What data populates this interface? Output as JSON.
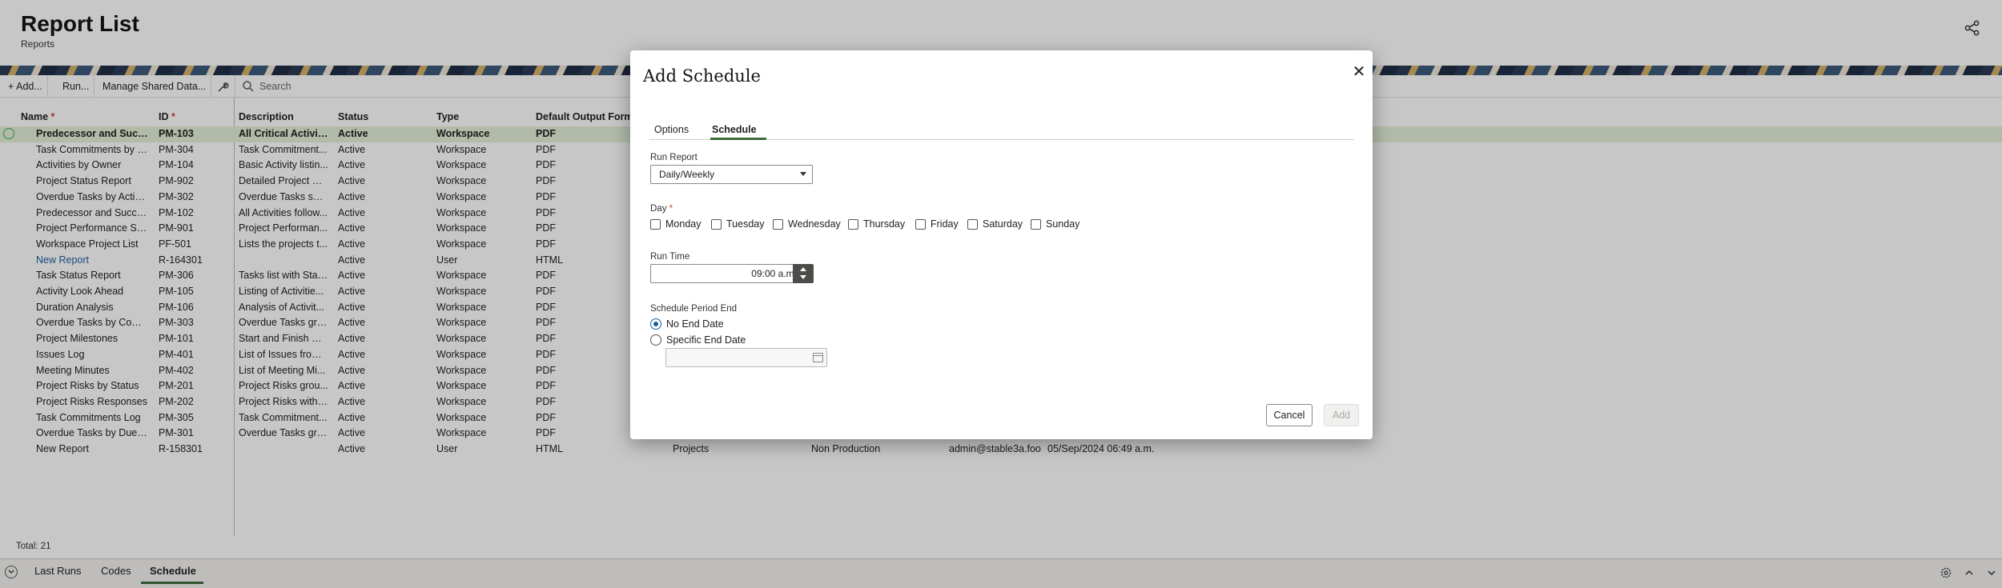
{
  "header": {
    "title": "Report List",
    "subtitle": "Reports",
    "share_icon": "share-icon"
  },
  "toolbar": {
    "add_label": "Add...",
    "run_label": "Run...",
    "manage_label": "Manage Shared Data...",
    "search_placeholder": "Search"
  },
  "table": {
    "headers": {
      "name": "Name",
      "id": "ID",
      "description": "Description",
      "status": "Status",
      "type": "Type",
      "format": "Default Output Format"
    },
    "rows": [
      {
        "name": "Predecessor and Succe...",
        "id": "PM-103",
        "desc": "All Critical Activiti...",
        "status": "Active",
        "type": "Workspace",
        "fmt": "PDF"
      },
      {
        "name": "Task Commitments by S...",
        "id": "PM-304",
        "desc": "Task Commitment...",
        "status": "Active",
        "type": "Workspace",
        "fmt": "PDF"
      },
      {
        "name": "Activities by Owner",
        "id": "PM-104",
        "desc": "Basic Activity listin...",
        "status": "Active",
        "type": "Workspace",
        "fmt": "PDF"
      },
      {
        "name": "Project Status Report",
        "id": "PM-902",
        "desc": "Detailed Project St...",
        "status": "Active",
        "type": "Workspace",
        "fmt": "PDF"
      },
      {
        "name": "Overdue Tasks by Activi...",
        "id": "PM-302",
        "desc": "Overdue Tasks sor...",
        "status": "Active",
        "type": "Workspace",
        "fmt": "PDF"
      },
      {
        "name": "Predecessor and Succes...",
        "id": "PM-102",
        "desc": "All Activities follow...",
        "status": "Active",
        "type": "Workspace",
        "fmt": "PDF"
      },
      {
        "name": "Project Performance Su...",
        "id": "PM-901",
        "desc": "Project Performan...",
        "status": "Active",
        "type": "Workspace",
        "fmt": "PDF"
      },
      {
        "name": "Workspace Project List",
        "id": "PF-501",
        "desc": "Lists the projects t...",
        "status": "Active",
        "type": "Workspace",
        "fmt": "PDF"
      },
      {
        "name": "New Report",
        "id": "R-164301",
        "desc": "",
        "status": "Active",
        "type": "User",
        "fmt": "HTML",
        "link": true
      },
      {
        "name": "Task Status Report",
        "id": "PM-306",
        "desc": "Tasks list with Stat...",
        "status": "Active",
        "type": "Workspace",
        "fmt": "PDF"
      },
      {
        "name": "Activity Look Ahead",
        "id": "PM-105",
        "desc": "Listing of Activitie...",
        "status": "Active",
        "type": "Workspace",
        "fmt": "PDF"
      },
      {
        "name": "Duration Analysis",
        "id": "PM-106",
        "desc": "Analysis of Activit...",
        "status": "Active",
        "type": "Workspace",
        "fmt": "PDF"
      },
      {
        "name": "Overdue Tasks by Comp...",
        "id": "PM-303",
        "desc": "Overdue Tasks gro...",
        "status": "Active",
        "type": "Workspace",
        "fmt": "PDF"
      },
      {
        "name": "Project Milestones",
        "id": "PM-101",
        "desc": "Start and Finish Mi...",
        "status": "Active",
        "type": "Workspace",
        "fmt": "PDF"
      },
      {
        "name": "Issues Log",
        "id": "PM-401",
        "desc": "List of Issues from ...",
        "status": "Active",
        "type": "Workspace",
        "fmt": "PDF"
      },
      {
        "name": "Meeting Minutes",
        "id": "PM-402",
        "desc": "List of Meeting Mi...",
        "status": "Active",
        "type": "Workspace",
        "fmt": "PDF"
      },
      {
        "name": "Project Risks by Status",
        "id": "PM-201",
        "desc": "Project Risks grou...",
        "status": "Active",
        "type": "Workspace",
        "fmt": "PDF"
      },
      {
        "name": "Project Risks Responses",
        "id": "PM-202",
        "desc": "Project Risks with ...",
        "status": "Active",
        "type": "Workspace",
        "fmt": "PDF"
      },
      {
        "name": "Task Commitments Log",
        "id": "PM-305",
        "desc": "Task Commitment...",
        "status": "Active",
        "type": "Workspace",
        "fmt": "PDF"
      },
      {
        "name": "Overdue Tasks by Due D...",
        "id": "PM-301",
        "desc": "Overdue Tasks gro...",
        "status": "Active",
        "type": "Workspace",
        "fmt": "PDF"
      },
      {
        "name": "New Report",
        "id": "R-158301",
        "desc": "",
        "status": "Active",
        "type": "User",
        "fmt": "HTML",
        "x1": "Projects",
        "x2": "Non Production",
        "x3": "admin@stable3a.foo",
        "x4": "05/Sep/2024 06:49 a.m."
      }
    ],
    "total": "Total: 21"
  },
  "bottom_tabs": [
    "Last Runs",
    "Codes",
    "Schedule"
  ],
  "dialog": {
    "title": "Add Schedule",
    "tabs": [
      "Options",
      "Schedule"
    ],
    "run_report_label": "Run Report",
    "run_report_value": "Daily/Weekly",
    "day_label": "Day",
    "days": [
      "Monday",
      "Tuesday",
      "Wednesday",
      "Thursday",
      "Friday",
      "Saturday",
      "Sunday"
    ],
    "run_time_label": "Run Time",
    "run_time_value": "09:00 a.m.",
    "period_end_label": "Schedule Period End",
    "no_end_label": "No End Date",
    "specific_end_label": "Specific End Date",
    "cancel_label": "Cancel",
    "add_label": "Add"
  }
}
